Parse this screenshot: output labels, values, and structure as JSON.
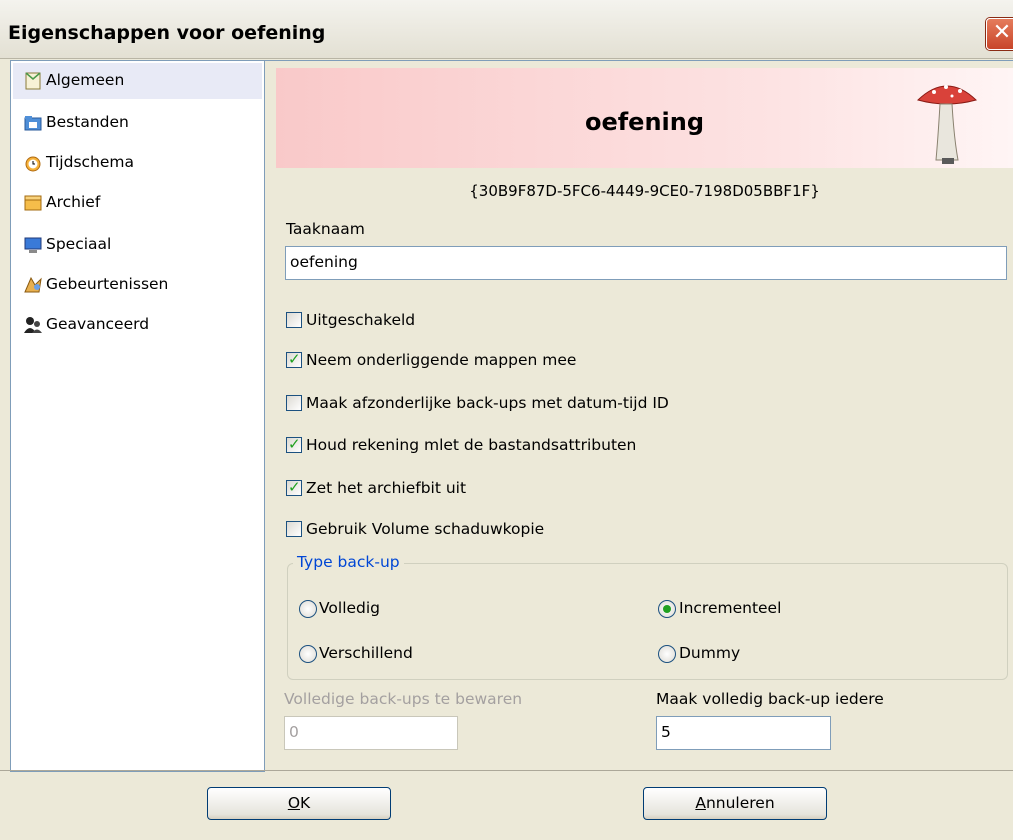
{
  "window": {
    "title": "Eigenschappen voor oefening",
    "close_glyph": "✕"
  },
  "sidebar": {
    "items": [
      {
        "label": "Algemeen",
        "icon": "notepad-icon",
        "selected": true
      },
      {
        "label": "Bestanden",
        "icon": "folder-files-icon",
        "selected": false
      },
      {
        "label": "Tijdschema",
        "icon": "alarm-clock-icon",
        "selected": false
      },
      {
        "label": "Archief",
        "icon": "archive-box-icon",
        "selected": false
      },
      {
        "label": "Speciaal",
        "icon": "monitor-icon",
        "selected": false
      },
      {
        "label": "Gebeurtenissen",
        "icon": "events-icon",
        "selected": false
      },
      {
        "label": "Geavanceerd",
        "icon": "advanced-users-icon",
        "selected": false
      }
    ]
  },
  "header": {
    "title": "oefening",
    "guid": "{30B9F87D-5FC6-4449-9CE0-7198D05BBF1F}",
    "icon": "mushroom-icon"
  },
  "form": {
    "taaknaam_label": "Taaknaam",
    "taaknaam_value": "oefening",
    "options": [
      {
        "label": "Uitgeschakeld",
        "checked": false
      },
      {
        "label": "Neem onderliggende mappen mee",
        "checked": true
      },
      {
        "label": "Maak afzonderlijke back-ups met datum-tijd ID",
        "checked": false
      },
      {
        "label": "Houd rekening mlet de bastandsattributen",
        "checked": true
      },
      {
        "label": "Zet het archiefbit uit",
        "checked": true
      },
      {
        "label": "Gebruik Volume schaduwkopie",
        "checked": false
      }
    ],
    "check_glyph": "✓",
    "backup_type": {
      "legend": "Type back-up",
      "options": [
        {
          "label": "Volledig",
          "selected": false
        },
        {
          "label": "Incrementeel",
          "selected": true
        },
        {
          "label": "Verschillend",
          "selected": false
        },
        {
          "label": "Dummy",
          "selected": false
        }
      ]
    },
    "keep_full_label": "Volledige back-ups te bewaren",
    "keep_full_value": "0",
    "full_every_label": "Maak volledig back-up iedere",
    "full_every_value": "5"
  },
  "buttons": {
    "ok_label_key": "O",
    "ok_label_rest": "K",
    "cancel_label_key": "A",
    "cancel_label_rest": "nnuleren"
  },
  "colors": {
    "accent": "#0046d5",
    "check": "#21a121",
    "banner": "#f9c9c9"
  }
}
